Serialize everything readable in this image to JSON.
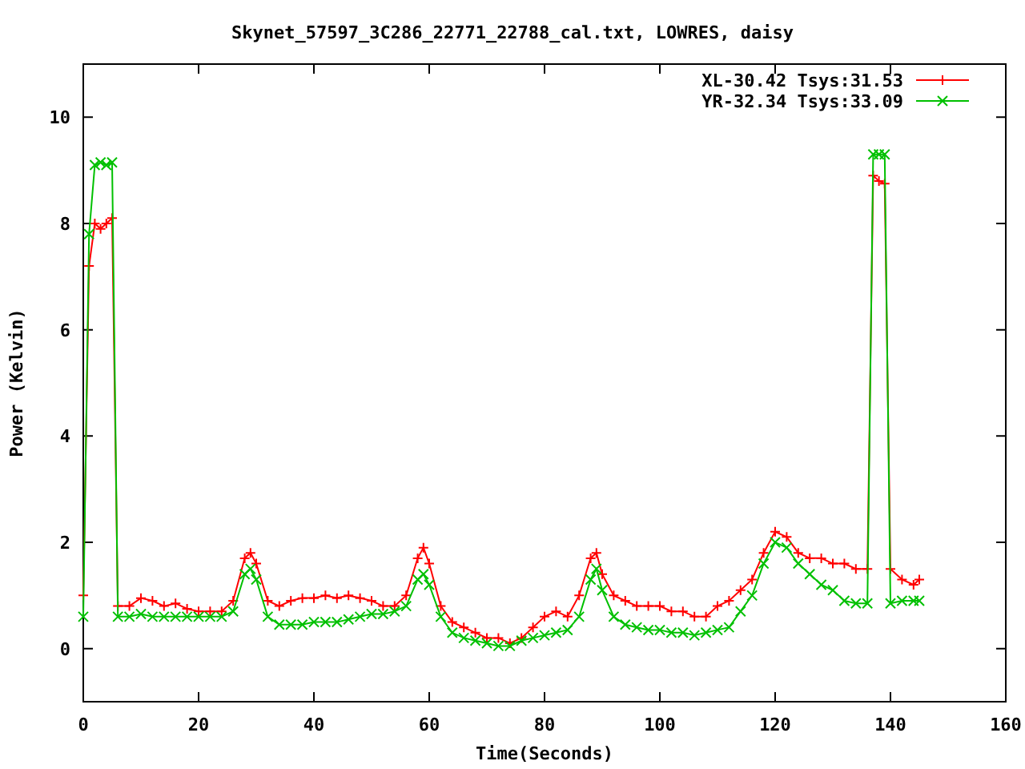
{
  "chart_data": {
    "type": "line",
    "title": "Skynet_57597_3C286_22771_22788_cal.txt, LOWRES, daisy",
    "xlabel": "Time(Seconds)",
    "ylabel": "Power (Kelvin)",
    "xlim": [
      0,
      160
    ],
    "ylim": [
      -1,
      11
    ],
    "legend": true,
    "xticks": [
      0,
      20,
      40,
      60,
      80,
      100,
      120,
      140,
      160
    ],
    "yticks": [
      0,
      2,
      4,
      6,
      8,
      10
    ],
    "x": [
      0,
      1,
      2,
      3,
      4,
      5,
      6,
      8,
      10,
      12,
      14,
      16,
      18,
      20,
      22,
      24,
      26,
      28,
      29,
      30,
      32,
      34,
      36,
      38,
      40,
      42,
      44,
      46,
      48,
      50,
      52,
      54,
      56,
      58,
      59,
      60,
      62,
      64,
      66,
      68,
      70,
      72,
      74,
      76,
      78,
      80,
      82,
      84,
      86,
      88,
      89,
      90,
      92,
      94,
      96,
      98,
      100,
      102,
      104,
      106,
      108,
      110,
      112,
      114,
      116,
      118,
      120,
      122,
      124,
      126,
      128,
      130,
      132,
      134,
      136,
      137,
      138,
      139,
      140,
      142,
      144,
      145
    ],
    "series": [
      {
        "name": "XL-30.42 Tsys:31.53",
        "color": "#ff0000",
        "marker": "plus",
        "values": [
          1.0,
          7.2,
          8.0,
          7.9,
          8.0,
          8.1,
          0.8,
          0.8,
          0.95,
          0.9,
          0.8,
          0.85,
          0.75,
          0.7,
          0.7,
          0.7,
          0.9,
          1.7,
          1.8,
          1.6,
          0.9,
          0.8,
          0.9,
          0.95,
          0.95,
          1.0,
          0.95,
          1.0,
          0.95,
          0.9,
          0.8,
          0.8,
          1.0,
          1.7,
          1.9,
          1.6,
          0.8,
          0.5,
          0.4,
          0.3,
          0.2,
          0.2,
          0.1,
          0.2,
          0.4,
          0.6,
          0.7,
          0.6,
          1.0,
          1.7,
          1.8,
          1.4,
          1.0,
          0.9,
          0.8,
          0.8,
          0.8,
          0.7,
          0.7,
          0.6,
          0.6,
          0.8,
          0.9,
          1.1,
          1.3,
          1.8,
          2.2,
          2.1,
          1.8,
          1.7,
          1.7,
          1.6,
          1.6,
          1.5,
          1.5,
          8.9,
          8.8,
          8.75,
          1.5,
          1.3,
          1.2,
          1.3
        ]
      },
      {
        "name": "YR-32.34 Tsys:33.09",
        "color": "#00c000",
        "marker": "cross",
        "values": [
          0.6,
          7.8,
          9.1,
          9.15,
          9.1,
          9.15,
          0.6,
          0.6,
          0.65,
          0.6,
          0.6,
          0.6,
          0.6,
          0.6,
          0.6,
          0.6,
          0.7,
          1.4,
          1.5,
          1.3,
          0.6,
          0.45,
          0.45,
          0.45,
          0.5,
          0.5,
          0.5,
          0.55,
          0.6,
          0.65,
          0.65,
          0.7,
          0.8,
          1.3,
          1.4,
          1.2,
          0.6,
          0.3,
          0.2,
          0.15,
          0.1,
          0.05,
          0.05,
          0.15,
          0.2,
          0.25,
          0.3,
          0.35,
          0.6,
          1.3,
          1.5,
          1.1,
          0.6,
          0.45,
          0.4,
          0.35,
          0.35,
          0.3,
          0.3,
          0.25,
          0.3,
          0.35,
          0.4,
          0.7,
          1.0,
          1.6,
          2.0,
          1.9,
          1.6,
          1.4,
          1.2,
          1.1,
          0.9,
          0.85,
          0.85,
          9.3,
          9.3,
          9.3,
          0.85,
          0.9,
          0.9,
          0.9
        ]
      }
    ]
  }
}
